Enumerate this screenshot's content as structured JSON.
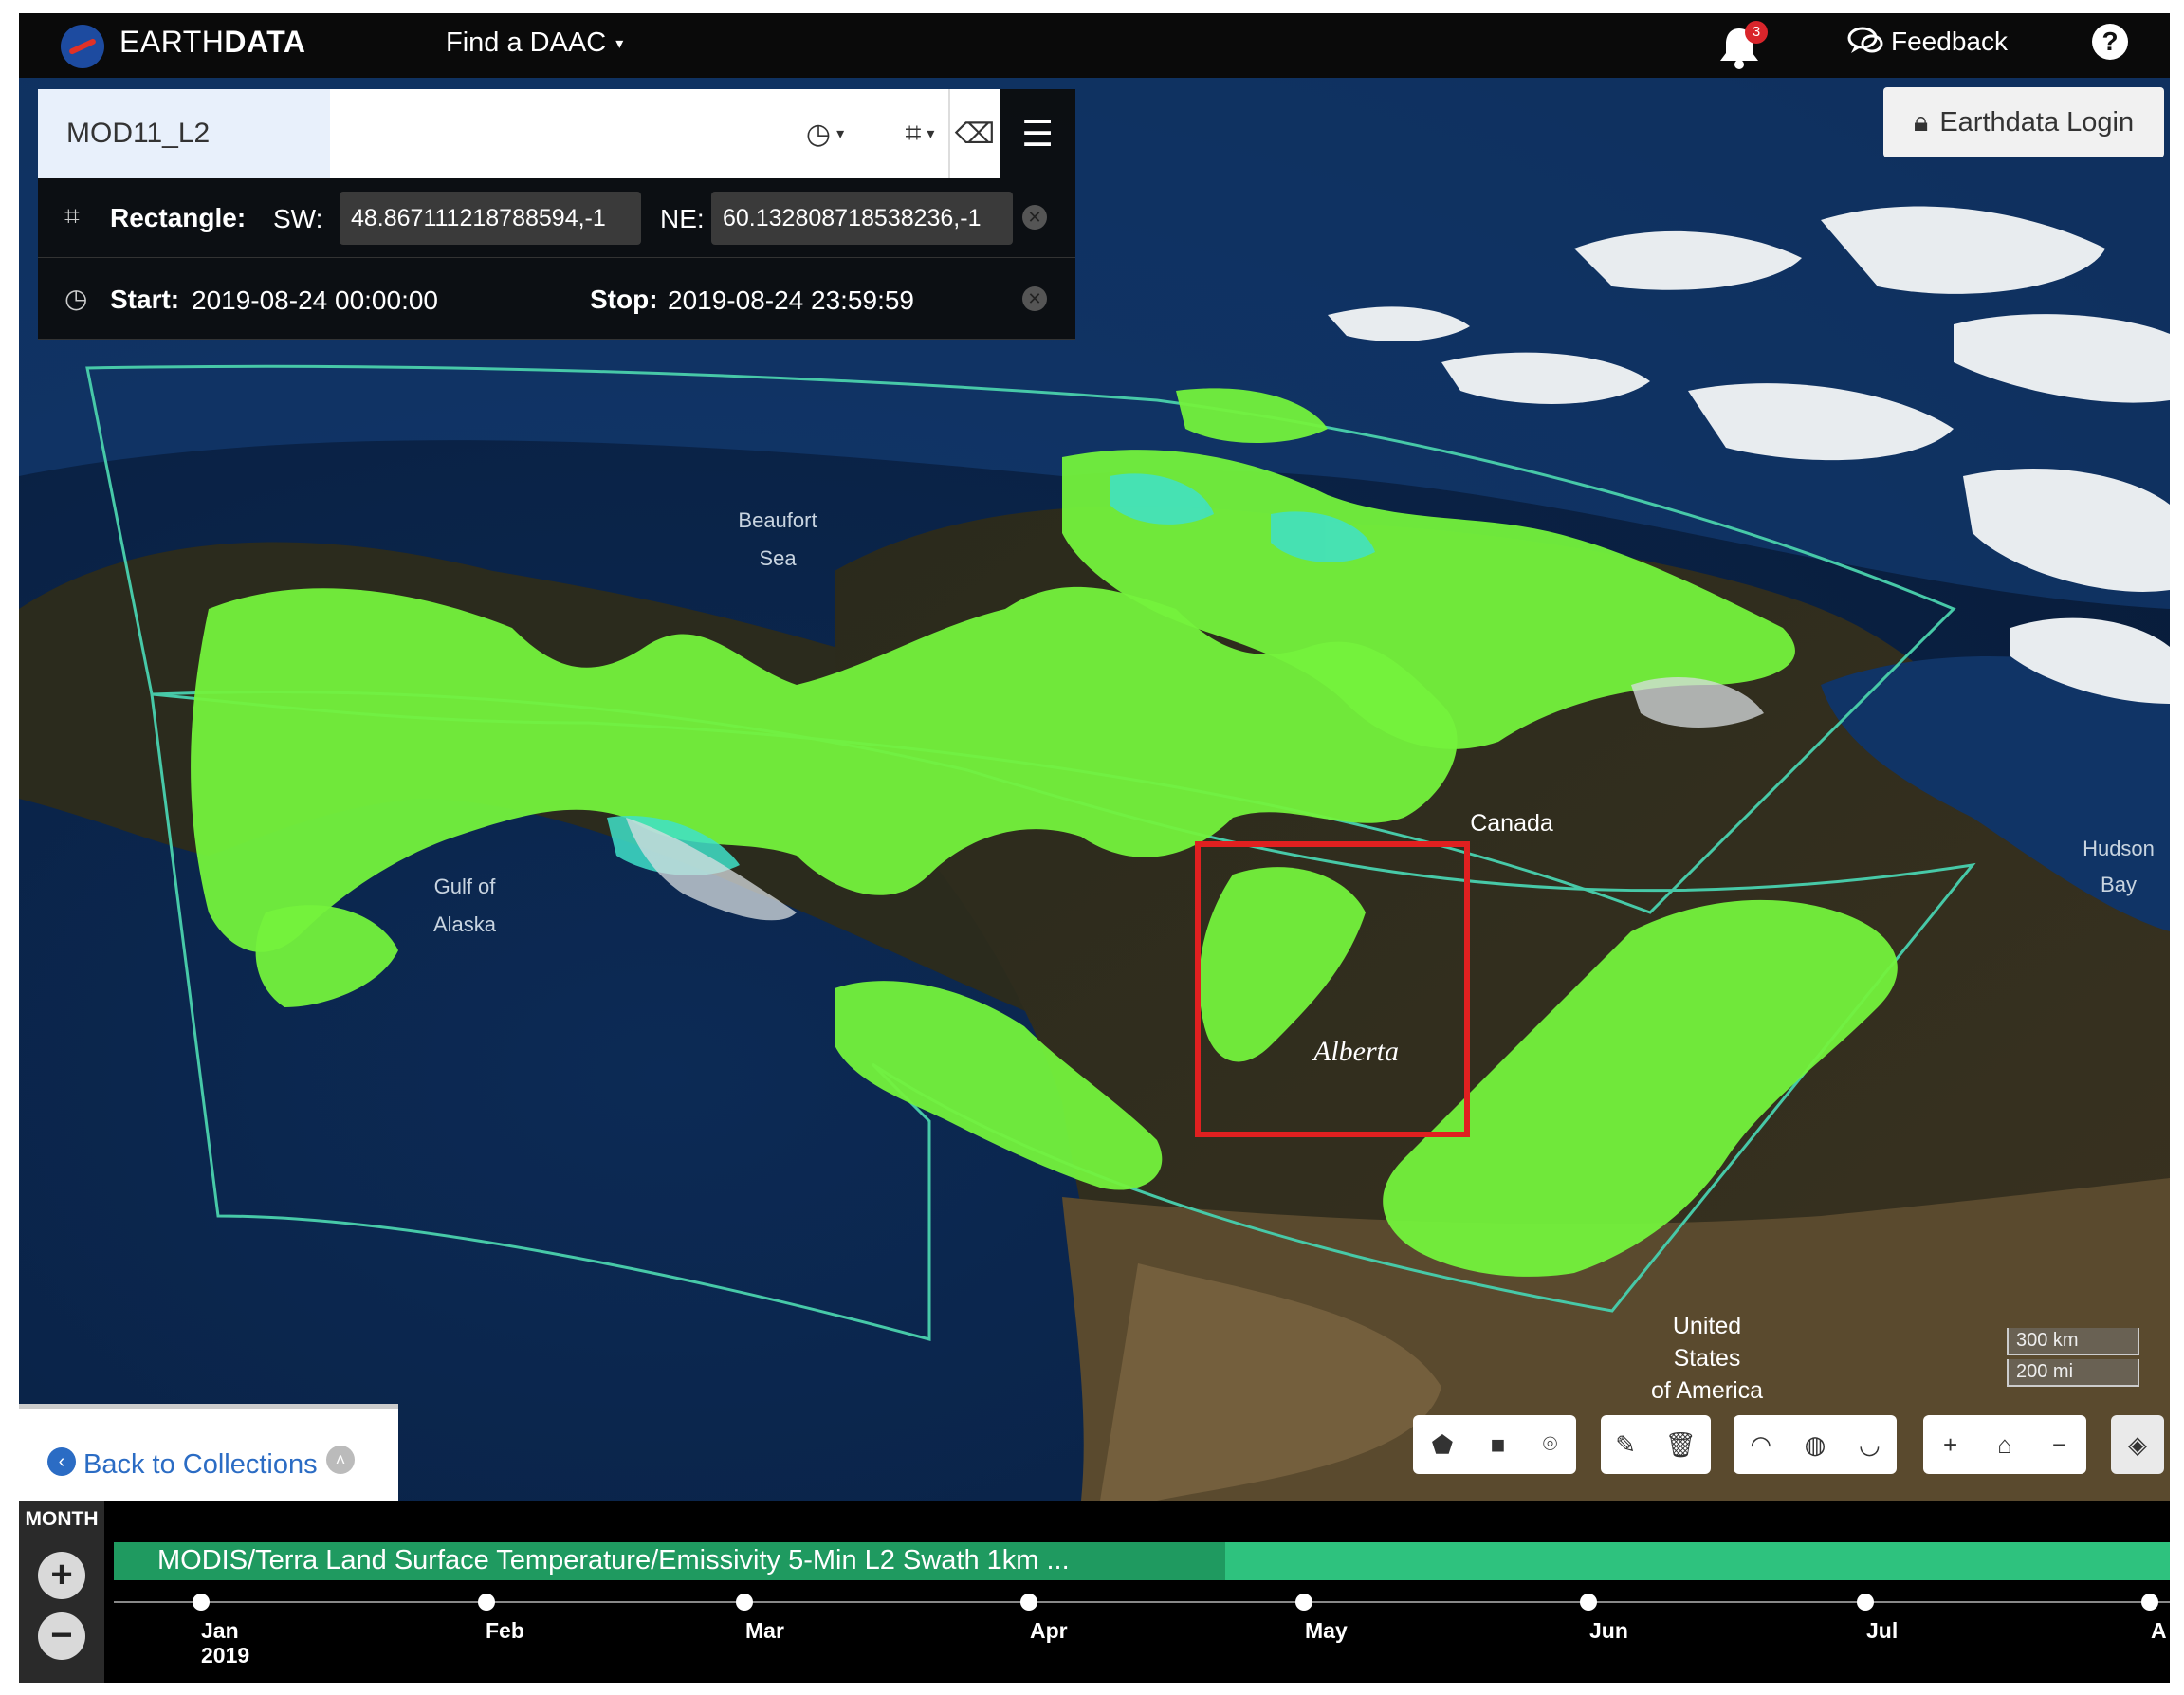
{
  "header": {
    "brand_plain": "EARTH",
    "brand_bold": "DATA",
    "find_daac": "Find a DAAC",
    "notification_count": "3",
    "feedback": "Feedback",
    "help": "?"
  },
  "search": {
    "query": "MOD11_L2",
    "rectangle_label": "Rectangle:",
    "sw_label": "SW:",
    "sw_value": "48.867111218788594,-1",
    "ne_label": "NE:",
    "ne_value": "60.132808718538236,-1",
    "start_label": "Start:",
    "start_value": "2019-08-24 00:00:00",
    "stop_label": "Stop:",
    "stop_value": "2019-08-24 23:59:59"
  },
  "login": {
    "label": "Earthdata Login"
  },
  "map": {
    "labels": {
      "beaufort_1": "Beaufort",
      "beaufort_2": "Sea",
      "gulf_1": "Gulf of",
      "gulf_2": "Alaska",
      "canada": "Canada",
      "hudson_1": "Hudson",
      "hudson_2": "Bay",
      "usa_1": "United",
      "usa_2": "States",
      "usa_3": "of America",
      "alberta": "Alberta"
    },
    "scale_km": "300 km",
    "scale_mi": "200 mi"
  },
  "nav": {
    "back_to_collections": "Back to Collections"
  },
  "timeline": {
    "zoom_level": "MONTH",
    "collection_title": "MODIS/Terra Land Surface Temperature/Emissivity 5-Min L2 Swath 1km ...",
    "months": [
      "Jan",
      "Feb",
      "Mar",
      "Apr",
      "May",
      "Jun",
      "Jul",
      "A"
    ],
    "year": "2019"
  },
  "colors": {
    "header_bg": "#0a0a0a",
    "swath_green": "#7dff3c",
    "timeline_green": "#2ec27e",
    "selection_red": "#e02020",
    "link_blue": "#2b6cc4"
  }
}
